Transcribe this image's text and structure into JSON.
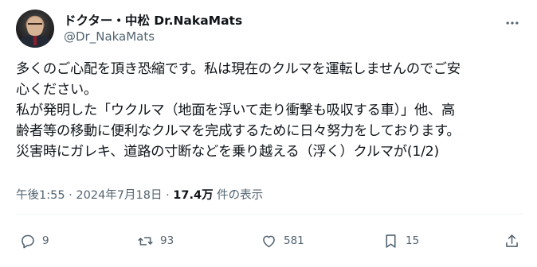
{
  "author": {
    "name": "ドクター・中松 Dr.NakaMats",
    "handle": "@Dr_NakaMats"
  },
  "tweet": {
    "lines": [
      "多くのご心配を頂き恐縮です。私は現在のクルマを運転しませんのでご安",
      "心ください。",
      "私が発明した「ウクルマ（地面を浮いて走り衝撃も吸収する車）」他、高",
      "齢者等の移動に便利なクルマを完成するために日々努力をしております。",
      "災害時にガレキ、道路の寸断などを乗り越える（浮く）クルマが(1/2)"
    ]
  },
  "meta": {
    "time": "午後1:55",
    "sep1": " · ",
    "date": "2024年7月18日",
    "sep2": " · ",
    "views": "17.4万",
    "views_suffix": " 件の表示"
  },
  "actions": {
    "reply_count": "9",
    "repost_count": "93",
    "like_count": "581",
    "bookmark_count": "15"
  },
  "icons": {
    "more": "more-horizontal-icon",
    "reply": "reply-icon",
    "repost": "repost-icon",
    "like": "heart-icon",
    "bookmark": "bookmark-icon",
    "share": "share-icon"
  },
  "colors": {
    "text": "#0f1419",
    "secondary": "#536471",
    "divider": "#eff3f4"
  }
}
